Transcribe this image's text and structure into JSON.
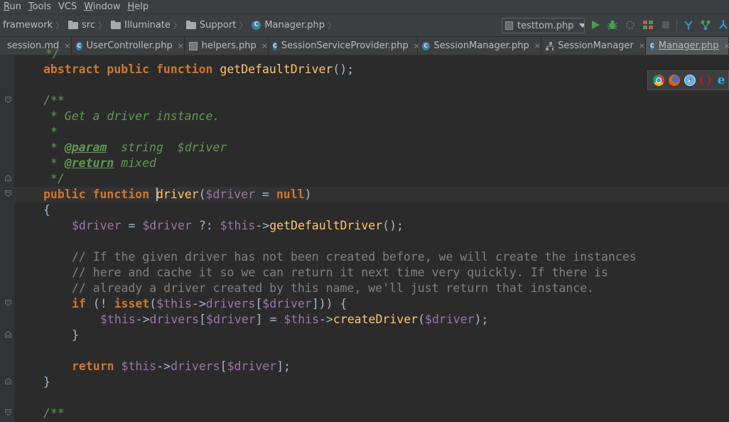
{
  "menu": [
    "Run",
    "Tools",
    "VCS",
    "Window",
    "Help"
  ],
  "menu_mnemonic": [
    "R",
    "T",
    "",
    "W",
    "H"
  ],
  "breadcrumb": [
    "framework",
    "src",
    "Illuminate",
    "Support",
    "Manager.php"
  ],
  "run_config": "testtom.php",
  "tabs": [
    {
      "label": "session.md"
    },
    {
      "label": "UserController.php"
    },
    {
      "label": "helpers.php"
    },
    {
      "label": "SessionServiceProvider.php"
    },
    {
      "label": "SessionManager.php"
    },
    {
      "label": "SessionManager"
    },
    {
      "label": "Manager.php"
    }
  ],
  "active_tab": "Manager.php",
  "tab_close": "×",
  "browsers": [
    "chrome-icon",
    "firefox-icon",
    "safari-icon",
    "opera-icon",
    "ie-icon"
  ],
  "code": {
    "l0": {
      "p0": "*/"
    },
    "l1": {
      "k1": "abstract",
      "k2": "public",
      "k3": "function",
      "fn": "getDefaultDriver",
      "p": "();"
    },
    "l3": {
      "d": "/**"
    },
    "l4": {
      "d": " * Get a driver instance."
    },
    "l5": {
      "d": " *"
    },
    "l6": {
      "d1": " * ",
      "tag": "@param",
      "d2": "  string  $driver"
    },
    "l7": {
      "d1": " * ",
      "tag": "@return",
      "d2": " mixed"
    },
    "l8": {
      "d": " */"
    },
    "l9": {
      "k1": "public",
      "k2": "function",
      "fn": "driver",
      "p1": "(",
      "v": "$driver",
      "p2": " = ",
      "k3": "null",
      "p3": ")"
    },
    "l10": {
      "p": "{"
    },
    "l11": {
      "v1": "$driver",
      "p1": " = ",
      "v2": "$driver",
      "p2": " ?: ",
      "v3": "$this",
      "p3": "->",
      "fn": "getDefaultDriver",
      "p4": "();"
    },
    "l13": {
      "c": "// If the given driver has not been created before, we will create the instances"
    },
    "l14": {
      "c": "// here and cache it so we can return it next time very quickly. If there is"
    },
    "l15": {
      "c": "// already a driver created by this name, we'll just return that instance."
    },
    "l16": {
      "k": "if",
      "p1": " (! ",
      "k2": "isset",
      "p2": "(",
      "v1": "$this",
      "p3": "->",
      "prop": "drivers",
      "p4": "[",
      "v2": "$driver",
      "p5": "])) {"
    },
    "l17": {
      "v1": "$this",
      "p1": "->",
      "prop": "drivers",
      "p2": "[",
      "v2": "$driver",
      "p3": "] = ",
      "v3": "$this",
      "p4": "->",
      "fn": "createDriver",
      "p5": "(",
      "v4": "$driver",
      "p6": ");"
    },
    "l18": {
      "p": "}"
    },
    "l20": {
      "k": "return",
      "p1": " ",
      "v1": "$this",
      "p2": "->",
      "prop": "drivers",
      "p3": "[",
      "v2": "$driver",
      "p4": "];"
    },
    "l21": {
      "p": "}"
    },
    "l23": {
      "d": "/**"
    }
  }
}
